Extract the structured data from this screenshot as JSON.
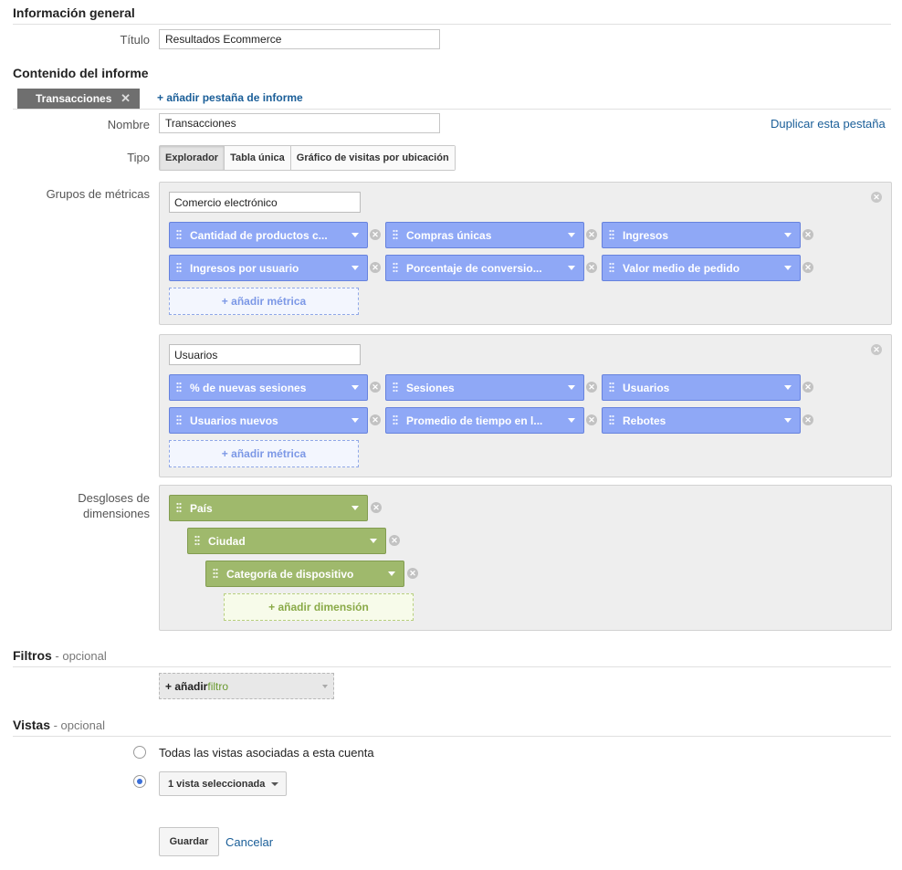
{
  "general": {
    "heading": "Información general",
    "title_label": "Título",
    "title_value": "Resultados Ecommerce"
  },
  "content": {
    "heading": "Contenido del informe",
    "active_tab": "Transacciones",
    "add_tab": "+ añadir pestaña de informe",
    "name_label": "Nombre",
    "name_value": "Transacciones",
    "duplicate": "Duplicar esta pestaña",
    "type_label": "Tipo",
    "types": [
      "Explorador",
      "Tabla única",
      "Gráfico de visitas por ubicación"
    ],
    "metric_groups_label": "Grupos de métricas",
    "groups": [
      {
        "name": "Comercio electrónico",
        "metrics": [
          "Cantidad de productos c...",
          "Compras únicas",
          "Ingresos",
          "Ingresos por usuario",
          "Porcentaje de conversio...",
          "Valor medio de pedido"
        ],
        "add_label": "+ añadir métrica"
      },
      {
        "name": "Usuarios",
        "metrics": [
          "% de nuevas sesiones",
          "Sesiones",
          "Usuarios",
          "Usuarios nuevos",
          "Promedio de tiempo en l...",
          "Rebotes"
        ],
        "add_label": "+ añadir métrica"
      }
    ],
    "dimensions_label_1": "Desgloses de",
    "dimensions_label_2": "dimensiones",
    "dimensions": [
      "País",
      "Ciudad",
      "Categoría de dispositivo"
    ],
    "add_dimension": "+ añadir dimensión"
  },
  "filters": {
    "heading": "Filtros",
    "optional": " - opcional",
    "add_plus": "+ añadir ",
    "add_word": "filtro"
  },
  "views": {
    "heading": "Vistas",
    "optional": " - opcional",
    "all_views": "Todas las vistas asociadas a esta cuenta",
    "selected": "1 vista seleccionada"
  },
  "actions": {
    "save": "Guardar",
    "cancel": "Cancelar"
  }
}
